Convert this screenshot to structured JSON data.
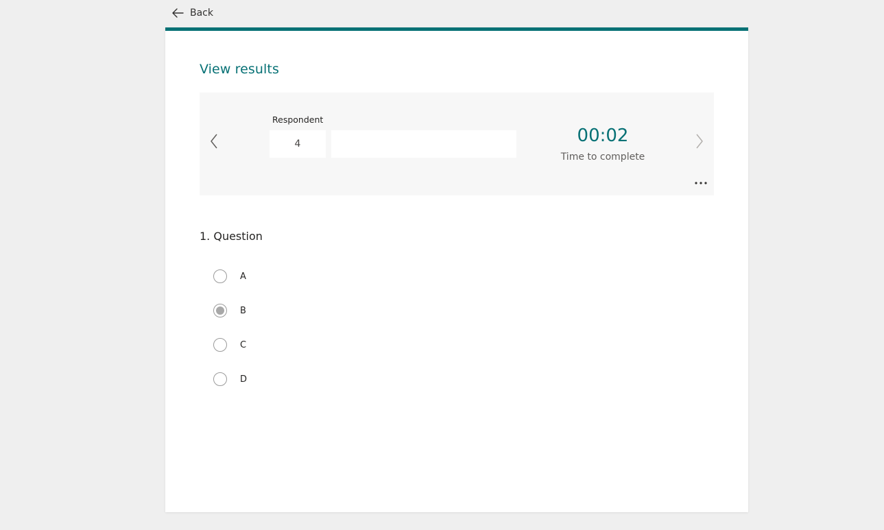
{
  "nav": {
    "back_label": "Back"
  },
  "page": {
    "title": "View results"
  },
  "respondent": {
    "label": "Respondent",
    "number": "4",
    "name": "",
    "time_value": "00:02",
    "time_label": "Time to complete"
  },
  "question": {
    "title": "1. Question",
    "options": [
      {
        "label": "A",
        "checked": false
      },
      {
        "label": "B",
        "checked": true
      },
      {
        "label": "C",
        "checked": false
      },
      {
        "label": "D",
        "checked": false
      }
    ]
  },
  "colors": {
    "accent": "#077175",
    "background": "#efefef",
    "panel": "#f7f7f7"
  }
}
